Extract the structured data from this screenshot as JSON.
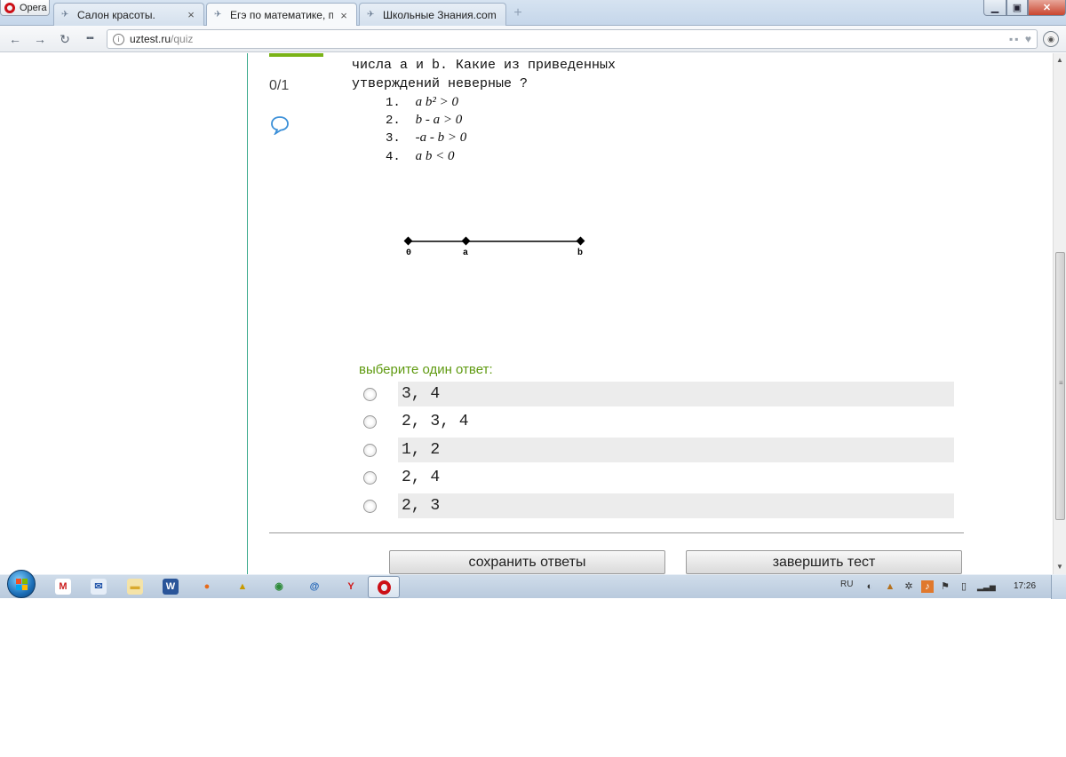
{
  "browser": {
    "menu_label": "Opera",
    "tabs": [
      {
        "title": "Салон красоты.",
        "active": false
      },
      {
        "title": "Егэ по математике, подго",
        "active": true
      },
      {
        "title": "Школьные Знания.com -",
        "active": false
      }
    ],
    "new_tab_icon": "plus-icon",
    "address": {
      "host": "uztest.ru",
      "path": "/quiz"
    }
  },
  "quiz": {
    "score": "0/1",
    "question_line1": "числа a и b. Какие из приведенных",
    "question_line2": "утверждений неверные ?",
    "statements": [
      {
        "num": "1.",
        "expr": "a b² > 0"
      },
      {
        "num": "2.",
        "expr": "b - a > 0"
      },
      {
        "num": "3.",
        "expr": "-a - b > 0"
      },
      {
        "num": "4.",
        "expr": "a b < 0"
      }
    ],
    "number_line": {
      "labels": [
        "0",
        "a",
        "b"
      ]
    },
    "prompt": "выберите один ответ:",
    "options": [
      {
        "label": "3, 4",
        "shaded": true
      },
      {
        "label": "2, 3, 4",
        "shaded": false
      },
      {
        "label": "1, 2",
        "shaded": true
      },
      {
        "label": "2, 4",
        "shaded": false
      },
      {
        "label": "2, 3",
        "shaded": true
      }
    ],
    "save_button": "сохранить ответы",
    "finish_button": "завершить тест"
  },
  "taskbar": {
    "language": "RU",
    "clock": "17:26",
    "pinned": [
      {
        "name": "gmail-icon",
        "glyph": "M",
        "color": "#cc2222"
      },
      {
        "name": "mail-icon",
        "glyph": "✉",
        "color": "#2255aa"
      },
      {
        "name": "folder-icon",
        "glyph": "▬",
        "color": "#d9a92e"
      },
      {
        "name": "word-icon",
        "glyph": "W",
        "color": "#2a5599"
      },
      {
        "name": "firefox-icon",
        "glyph": "●",
        "color": "#e66a1a"
      },
      {
        "name": "winamp-icon",
        "glyph": "▲",
        "color": "#c89a00"
      },
      {
        "name": "chrome-icon",
        "glyph": "◉",
        "color": "#2e8b3a"
      },
      {
        "name": "mailru-icon",
        "glyph": "@",
        "color": "#1a5fb4"
      },
      {
        "name": "yandex-icon",
        "glyph": "Y",
        "color": "#d11a1a"
      }
    ]
  },
  "colors": {
    "accent_green": "#5f9a10",
    "progress_bar": "#7ab317",
    "divider": "#3cab8d",
    "comment_icon": "#3a8fd8"
  }
}
